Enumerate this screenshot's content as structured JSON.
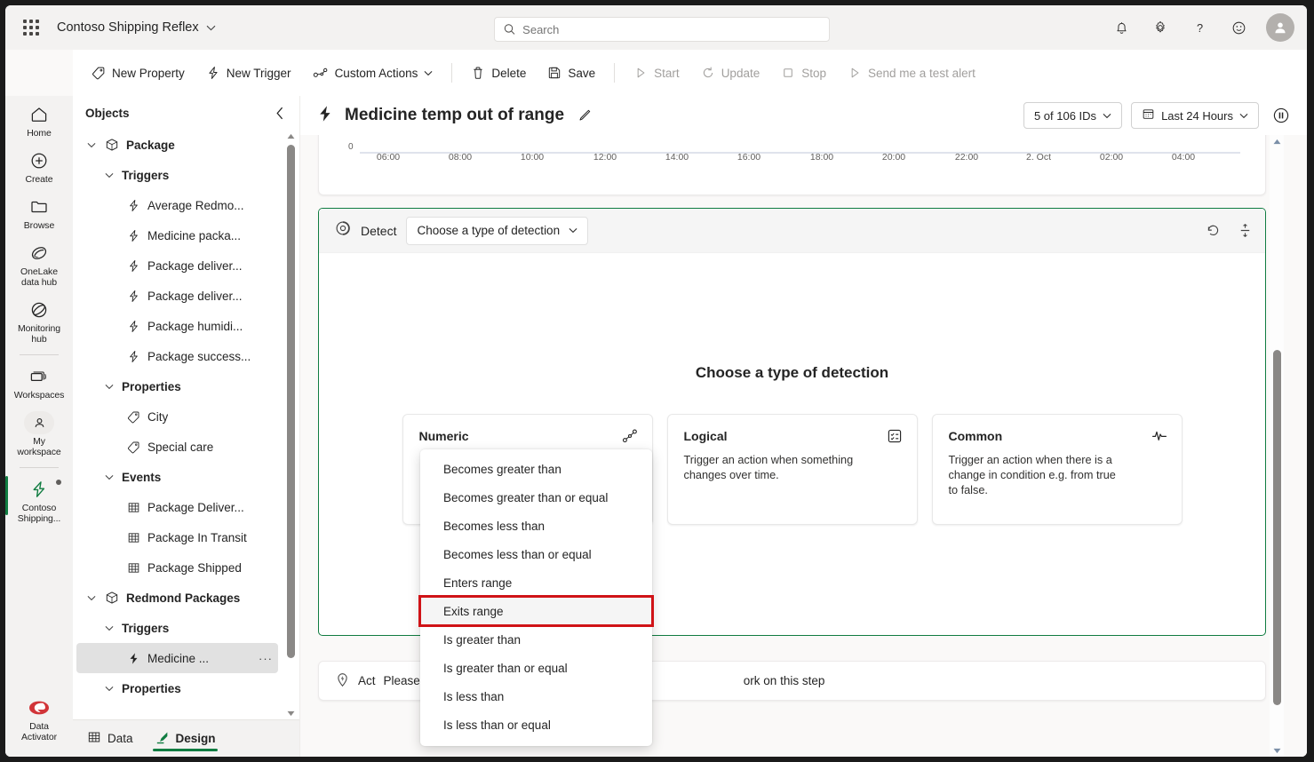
{
  "suite": {
    "waffle_icon": "app-grid-icon",
    "app_name": "Contoso Shipping Reflex",
    "search_placeholder": "Search",
    "icons": [
      "bell-icon",
      "gear-icon",
      "help-icon",
      "feedback-icon",
      "account-icon"
    ]
  },
  "command_bar": {
    "items": [
      {
        "label": "New Property",
        "icon": "tag-icon",
        "disabled": false
      },
      {
        "label": "New Trigger",
        "icon": "lightning-icon",
        "disabled": false
      },
      {
        "label": "Custom Actions",
        "icon": "actions-icon",
        "disabled": false,
        "caret": true
      },
      {
        "label": "Delete",
        "icon": "trash-icon",
        "disabled": false
      },
      {
        "label": "Save",
        "icon": "save-icon",
        "disabled": false
      },
      {
        "label": "Start",
        "icon": "play-icon",
        "disabled": true
      },
      {
        "label": "Update",
        "icon": "refresh-icon",
        "disabled": true
      },
      {
        "label": "Stop",
        "icon": "stop-icon",
        "disabled": true
      },
      {
        "label": "Send me a test alert",
        "icon": "play-icon",
        "disabled": true
      }
    ]
  },
  "rail": {
    "items": [
      {
        "label": "Home",
        "icon": "home-icon",
        "selected": false
      },
      {
        "label": "Create",
        "icon": "plus-circle-icon",
        "selected": false
      },
      {
        "label": "Browse",
        "icon": "folder-icon",
        "selected": false
      },
      {
        "label": "OneLake\ndata hub",
        "icon": "onelake-icon",
        "selected": false
      },
      {
        "label": "Monitoring\nhub",
        "icon": "monitoring-icon",
        "selected": false
      },
      {
        "label": "Workspaces",
        "icon": "workspaces-icon",
        "selected": false
      },
      {
        "label": "My\nworkspace",
        "icon": "person-icon",
        "selected": false
      },
      {
        "label": "Contoso\nShipping...",
        "icon": "reflex-icon",
        "selected": true
      }
    ],
    "bottom": {
      "label": "Data\nActivator",
      "icon": "data-activator-icon"
    }
  },
  "objects_panel": {
    "title": "Objects",
    "collapse_icon": "chevron-left-icon",
    "tree": [
      {
        "label": "Package",
        "level": 1,
        "icon": "object-icon",
        "expander": "chevron-down",
        "bold": true
      },
      {
        "label": "Triggers",
        "level": 2,
        "icon": "none",
        "expander": "chevron-down",
        "bold": true
      },
      {
        "label": "Average Redmo...",
        "level": 3,
        "icon": "trigger-icon",
        "expander": "none",
        "bold": false
      },
      {
        "label": "Medicine packa...",
        "level": 3,
        "icon": "trigger-icon",
        "expander": "none",
        "bold": false
      },
      {
        "label": "Package deliver...",
        "level": 3,
        "icon": "trigger-icon",
        "expander": "none",
        "bold": false
      },
      {
        "label": "Package deliver...",
        "level": 3,
        "icon": "trigger-icon",
        "expander": "none",
        "bold": false
      },
      {
        "label": "Package humidi...",
        "level": 3,
        "icon": "trigger-icon",
        "expander": "none",
        "bold": false
      },
      {
        "label": "Package success...",
        "level": 3,
        "icon": "trigger-icon",
        "expander": "none",
        "bold": false
      },
      {
        "label": "Properties",
        "level": 2,
        "icon": "none",
        "expander": "chevron-down",
        "bold": true
      },
      {
        "label": "City",
        "level": 3,
        "icon": "tag-icon",
        "expander": "none",
        "bold": false
      },
      {
        "label": "Special care",
        "level": 3,
        "icon": "tag-icon",
        "expander": "none",
        "bold": false
      },
      {
        "label": "Events",
        "level": 2,
        "icon": "none",
        "expander": "chevron-down",
        "bold": true
      },
      {
        "label": "Package Deliver...",
        "level": 3,
        "icon": "table-icon",
        "expander": "none",
        "bold": false
      },
      {
        "label": "Package In Transit",
        "level": 3,
        "icon": "table-icon",
        "expander": "none",
        "bold": false
      },
      {
        "label": "Package Shipped",
        "level": 3,
        "icon": "table-icon",
        "expander": "none",
        "bold": false
      },
      {
        "label": "Redmond Packages",
        "level": 1,
        "icon": "object-icon",
        "expander": "chevron-down",
        "bold": true
      },
      {
        "label": "Triggers",
        "level": 2,
        "icon": "none",
        "expander": "chevron-down",
        "bold": true
      },
      {
        "label": "Medicine ...",
        "level": 3,
        "icon": "trigger-filled-icon",
        "expander": "none",
        "bold": false,
        "selected": true,
        "more": "···"
      },
      {
        "label": "Properties",
        "level": 2,
        "icon": "none",
        "expander": "chevron-down",
        "bold": true
      }
    ],
    "footer_tabs": [
      {
        "label": "Data",
        "icon": "table-icon",
        "active": false
      },
      {
        "label": "Design",
        "icon": "design-pen-icon",
        "active": true
      }
    ]
  },
  "main_header": {
    "icon": "trigger-filled-icon",
    "title": "Medicine temp out of range",
    "edit_icon": "pencil-icon",
    "id_filter": "5 of 106 IDs",
    "time_range": "Last 24 Hours",
    "time_range_icon": "calendar-icon",
    "pause_icon": "pause-icon"
  },
  "chart_data": {
    "type": "line",
    "title": "",
    "xlabel": "",
    "ylabel": "",
    "y_axis_labels": [
      "0"
    ],
    "x_ticks": [
      "06:00",
      "08:00",
      "10:00",
      "12:00",
      "14:00",
      "16:00",
      "18:00",
      "20:00",
      "22:00",
      "2. Oct",
      "02:00",
      "04:00"
    ],
    "grid": false,
    "legend": "none",
    "note": "time axis of a 24-hour trend chart, scrolled so only the x-axis is visible"
  },
  "detect_section": {
    "icon": "detect-icon",
    "label": "Detect",
    "dropdown_value": "Choose a type of detection",
    "dropdown_caret": "chevron-down-icon",
    "undo_icon": "undo-icon",
    "threshold_icon": "threshold-icon",
    "heading": "Choose a type of detection",
    "cards": [
      {
        "title": "Numeric",
        "desc": "",
        "icon": "numeric-trend-icon"
      },
      {
        "title": "Logical",
        "desc": "Trigger an action when something changes over time.",
        "icon": "logical-icon"
      },
      {
        "title": "Common",
        "desc": "Trigger an action when there is a change in condition e.g. from true to false.",
        "icon": "pulse-icon"
      }
    ]
  },
  "detection_menu": {
    "highlight_color": "#d01317",
    "items": [
      {
        "label": "Becomes greater than",
        "highlighted": false
      },
      {
        "label": "Becomes greater than or equal",
        "highlighted": false
      },
      {
        "label": "Becomes less than",
        "highlighted": false
      },
      {
        "label": "Becomes less than or equal",
        "highlighted": false
      },
      {
        "label": "Enters range",
        "highlighted": false
      },
      {
        "label": "Exits range",
        "highlighted": true
      },
      {
        "label": "Is greater than",
        "highlighted": false
      },
      {
        "label": "Is greater than or equal",
        "highlighted": false
      },
      {
        "label": "Is less than",
        "highlighted": false
      },
      {
        "label": "Is less than or equal",
        "highlighted": false
      }
    ]
  },
  "act_section": {
    "icon": "act-icon",
    "label": "Act",
    "message_start": "Please",
    "message_end": "ork on this step"
  }
}
